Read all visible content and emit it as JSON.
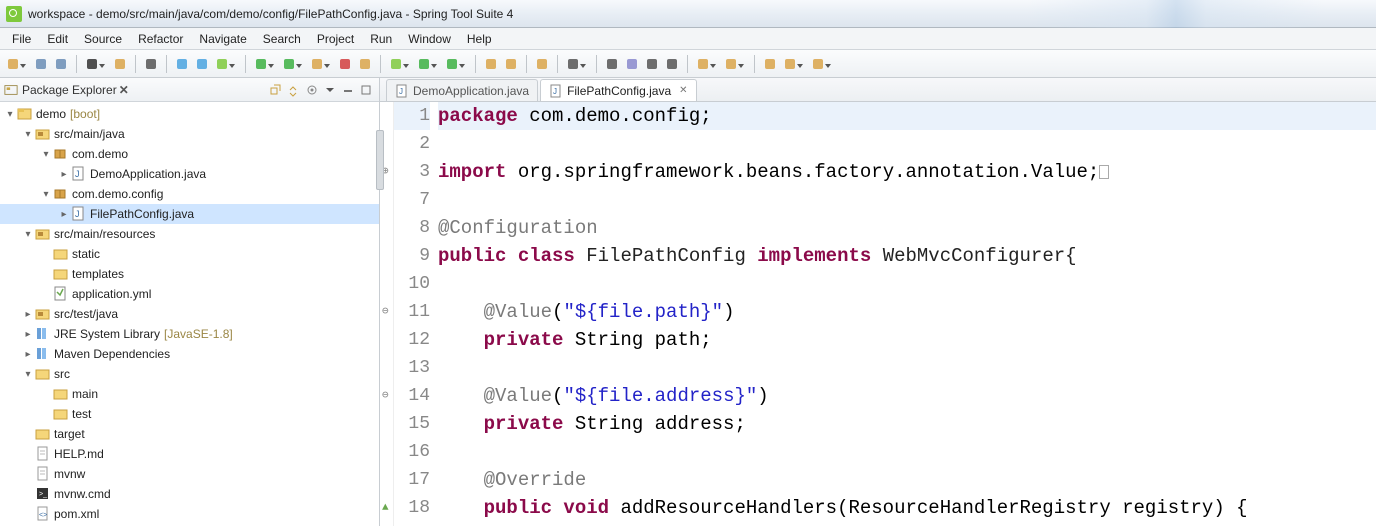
{
  "window": {
    "title": "workspace - demo/src/main/java/com/demo/config/FilePathConfig.java - Spring Tool Suite 4"
  },
  "menu": [
    "File",
    "Edit",
    "Source",
    "Refactor",
    "Navigate",
    "Search",
    "Project",
    "Run",
    "Window",
    "Help"
  ],
  "toolbar_icons": [
    {
      "name": "new-icon",
      "fill": "#d9a44a",
      "drop": true
    },
    {
      "name": "save-icon",
      "fill": "#6a8db5"
    },
    {
      "name": "save-all-icon",
      "fill": "#6a8db5"
    },
    {
      "name": "sep"
    },
    {
      "name": "switch-icon",
      "fill": "#333",
      "drop": true
    },
    {
      "name": "build-icon",
      "fill": "#d9a44a"
    },
    {
      "name": "sep"
    },
    {
      "name": "wand-icon",
      "fill": "#555"
    },
    {
      "name": "sep"
    },
    {
      "name": "debug-breakpoint-icon",
      "fill": "#4aa3df"
    },
    {
      "name": "skip-all-icon",
      "fill": "#4aa3df"
    },
    {
      "name": "debug-icon",
      "fill": "#7ec93d",
      "drop": true
    },
    {
      "name": "sep"
    },
    {
      "name": "run-icon",
      "fill": "#3cb043",
      "drop": true
    },
    {
      "name": "coverage-icon",
      "fill": "#3cb043",
      "drop": true
    },
    {
      "name": "run-last-icon",
      "fill": "#d9a44a",
      "drop": true
    },
    {
      "name": "terminate-icon",
      "fill": "#d13f3f"
    },
    {
      "name": "relaunch-icon",
      "fill": "#d9a44a"
    },
    {
      "name": "sep"
    },
    {
      "name": "new-pkg-icon",
      "fill": "#7ec93d",
      "drop": true
    },
    {
      "name": "new-class-icon",
      "fill": "#3cb043",
      "drop": true
    },
    {
      "name": "new-interface-icon",
      "fill": "#3cb043",
      "drop": true
    },
    {
      "name": "sep"
    },
    {
      "name": "open-type-icon",
      "fill": "#d9a44a"
    },
    {
      "name": "open-task-icon",
      "fill": "#d9a44a"
    },
    {
      "name": "sep"
    },
    {
      "name": "new-folder-icon",
      "fill": "#d9a44a"
    },
    {
      "name": "sep"
    },
    {
      "name": "search-icon",
      "fill": "#555",
      "drop": true
    },
    {
      "name": "sep"
    },
    {
      "name": "outline-icon",
      "fill": "#555"
    },
    {
      "name": "task-list-icon",
      "fill": "#8888cc"
    },
    {
      "name": "toggle-mark-icon",
      "fill": "#555"
    },
    {
      "name": "pin-icon",
      "fill": "#555"
    },
    {
      "name": "sep"
    },
    {
      "name": "next-ann-icon",
      "fill": "#d9a44a",
      "drop": true
    },
    {
      "name": "prev-ann-icon",
      "fill": "#d9a44a",
      "drop": true
    },
    {
      "name": "sep"
    },
    {
      "name": "last-edit-icon",
      "fill": "#d9a44a"
    },
    {
      "name": "back-icon",
      "fill": "#d9a44a",
      "drop": true
    },
    {
      "name": "forward-icon",
      "fill": "#d9a44a",
      "drop": true
    }
  ],
  "explorer": {
    "title": "Package Explorer",
    "tree": [
      {
        "d": 0,
        "exp": "▾",
        "icon": "project",
        "label": "demo",
        "dec": "[boot]"
      },
      {
        "d": 1,
        "exp": "▾",
        "icon": "srcfolder",
        "label": "src/main/java"
      },
      {
        "d": 2,
        "exp": "▾",
        "icon": "package",
        "label": "com.demo"
      },
      {
        "d": 3,
        "exp": "▸",
        "icon": "java",
        "label": "DemoApplication.java"
      },
      {
        "d": 2,
        "exp": "▾",
        "icon": "package",
        "label": "com.demo.config"
      },
      {
        "d": 3,
        "exp": "▸",
        "icon": "java",
        "label": "FilePathConfig.java",
        "sel": true
      },
      {
        "d": 1,
        "exp": "▾",
        "icon": "srcfolder",
        "label": "src/main/resources"
      },
      {
        "d": 2,
        "exp": "",
        "icon": "folder",
        "label": "static"
      },
      {
        "d": 2,
        "exp": "",
        "icon": "folder",
        "label": "templates"
      },
      {
        "d": 2,
        "exp": "",
        "icon": "yml",
        "label": "application.yml"
      },
      {
        "d": 1,
        "exp": "▸",
        "icon": "srcfolder",
        "label": "src/test/java"
      },
      {
        "d": 1,
        "exp": "▸",
        "icon": "library",
        "label": "JRE System Library",
        "dec": "[JavaSE-1.8]"
      },
      {
        "d": 1,
        "exp": "▸",
        "icon": "library",
        "label": "Maven Dependencies"
      },
      {
        "d": 1,
        "exp": "▾",
        "icon": "folder",
        "label": "src"
      },
      {
        "d": 2,
        "exp": "",
        "icon": "folder",
        "label": "main"
      },
      {
        "d": 2,
        "exp": "",
        "icon": "folder",
        "label": "test"
      },
      {
        "d": 1,
        "exp": "",
        "icon": "folder",
        "label": "target"
      },
      {
        "d": 1,
        "exp": "",
        "icon": "file",
        "label": "HELP.md"
      },
      {
        "d": 1,
        "exp": "",
        "icon": "file",
        "label": "mvnw"
      },
      {
        "d": 1,
        "exp": "",
        "icon": "cmd",
        "label": "mvnw.cmd"
      },
      {
        "d": 1,
        "exp": "",
        "icon": "xml",
        "label": "pom.xml"
      }
    ]
  },
  "tabs": [
    {
      "label": "DemoApplication.java",
      "active": false
    },
    {
      "label": "FilePathConfig.java",
      "active": true
    }
  ],
  "code": {
    "lines": [
      {
        "n": "1",
        "current": true,
        "tokens": [
          {
            "t": "package ",
            "c": "kw"
          },
          {
            "t": "com.demo.config;",
            "c": ""
          }
        ]
      },
      {
        "n": "2",
        "tokens": []
      },
      {
        "n": "3",
        "marker": "⊕",
        "tokens": [
          {
            "t": "import ",
            "c": "kw"
          },
          {
            "t": "org.springframework.beans.factory.annotation.Value;",
            "c": ""
          },
          {
            "t": "BOX",
            "c": "box"
          }
        ]
      },
      {
        "n": "7",
        "tokens": []
      },
      {
        "n": "8",
        "tokens": [
          {
            "t": "@Configuration",
            "c": "ann"
          }
        ]
      },
      {
        "n": "9",
        "tokens": [
          {
            "t": "public class ",
            "c": "kw"
          },
          {
            "t": "FilePathConfig ",
            "c": "cls"
          },
          {
            "t": "implements ",
            "c": "kw"
          },
          {
            "t": "WebMvcConfigurer{",
            "c": "cls"
          }
        ]
      },
      {
        "n": "10",
        "tokens": []
      },
      {
        "n": "11",
        "marker": "⊖",
        "tokens": [
          {
            "t": "    ",
            "c": ""
          },
          {
            "t": "@Value",
            "c": "ann"
          },
          {
            "t": "(",
            "c": ""
          },
          {
            "t": "\"${file.path}\"",
            "c": "str"
          },
          {
            "t": ")",
            "c": ""
          }
        ]
      },
      {
        "n": "12",
        "tokens": [
          {
            "t": "    ",
            "c": ""
          },
          {
            "t": "private ",
            "c": "kw"
          },
          {
            "t": "String path;",
            "c": ""
          }
        ]
      },
      {
        "n": "13",
        "tokens": []
      },
      {
        "n": "14",
        "marker": "⊖",
        "tokens": [
          {
            "t": "    ",
            "c": ""
          },
          {
            "t": "@Value",
            "c": "ann"
          },
          {
            "t": "(",
            "c": ""
          },
          {
            "t": "\"${file.address}\"",
            "c": "str"
          },
          {
            "t": ")",
            "c": ""
          }
        ]
      },
      {
        "n": "15",
        "tokens": [
          {
            "t": "    ",
            "c": ""
          },
          {
            "t": "private ",
            "c": "kw"
          },
          {
            "t": "String address;",
            "c": ""
          }
        ]
      },
      {
        "n": "16",
        "tokens": []
      },
      {
        "n": "17",
        "tokens": [
          {
            "t": "    ",
            "c": ""
          },
          {
            "t": "@Override",
            "c": "ann"
          }
        ]
      },
      {
        "n": "18",
        "marker": "▲",
        "markerColor": "#6aa84f",
        "tokens": [
          {
            "t": "    ",
            "c": ""
          },
          {
            "t": "public void ",
            "c": "kw"
          },
          {
            "t": "addResourceHandlers(ResourceHandlerRegistry registry) {",
            "c": ""
          }
        ]
      }
    ]
  }
}
